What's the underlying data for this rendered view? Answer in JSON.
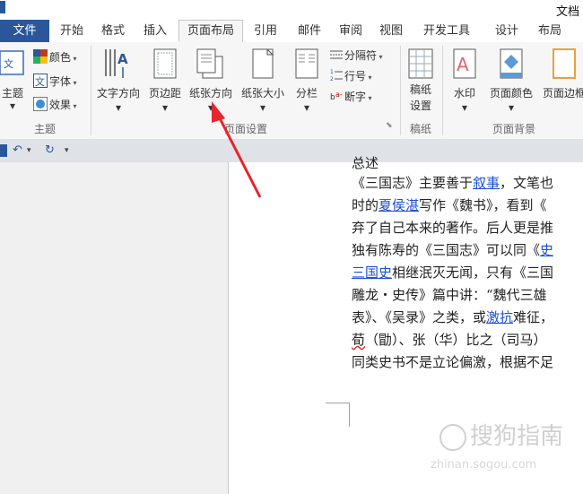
{
  "window": {
    "title": "文档"
  },
  "tabs": [
    {
      "label": "文件"
    },
    {
      "label": "开始"
    },
    {
      "label": "格式"
    },
    {
      "label": "插入"
    },
    {
      "label": "页面布局"
    },
    {
      "label": "引用"
    },
    {
      "label": "邮件"
    },
    {
      "label": "审阅"
    },
    {
      "label": "视图"
    },
    {
      "label": "开发工具"
    },
    {
      "label": "设计"
    },
    {
      "label": "布局"
    }
  ],
  "ribbon": {
    "theme": {
      "theme_label": "主题",
      "colors_label": "颜色",
      "fonts_label": "字体",
      "effects_label": "效果",
      "group_label": "主题"
    },
    "page_setup": {
      "text_direction": "文字方向",
      "margins": "页边距",
      "orientation": "纸张方向",
      "size": "纸张大小",
      "columns": "分栏",
      "breaks": "分隔符",
      "line_numbers": "行号",
      "hyphenation": "断字",
      "group_label": "页面设置"
    },
    "manuscript": {
      "label_1": "稿纸",
      "label_2": "设置",
      "group_label": "稿纸"
    },
    "page_background": {
      "watermark": "水印",
      "page_color": "页面颜色",
      "page_borders": "页面边框",
      "group_label": "页面背景"
    }
  },
  "doc": {
    "line0": "总述",
    "line1": {
      "a": "《三国志》主要善于",
      "link": "叙事",
      "b": "，文笔也"
    },
    "line2": {
      "a": "时的",
      "link": "夏侯湛",
      "b": "写作《魏书》，看到《"
    },
    "line3": "弃了自己本来的著作。后人更是推",
    "line4": {
      "a": "独有陈寿的《三国志》可以同《",
      "link": "史"
    },
    "line5": {
      "link": "三国史",
      "b": "相继泯灭无闻，只有《三国"
    },
    "line6": "雕龙・史传》篇中讲：“魏代三雄",
    "line7": {
      "a": "表》、《吴录》之类，或",
      "link": "激抗",
      "b": "难征，"
    },
    "line8": {
      "a": "荀",
      "b": "（勖）、张（华）比之（司马）"
    },
    "line9": "同类史书不是立论偏激，根据不足"
  },
  "watermark": {
    "main": "搜狗指南",
    "sub": "zhinan.sogou.com"
  },
  "colors": {
    "accent": "#2b579a",
    "link": "#1a4fd6",
    "arrow": "#e8242c"
  }
}
